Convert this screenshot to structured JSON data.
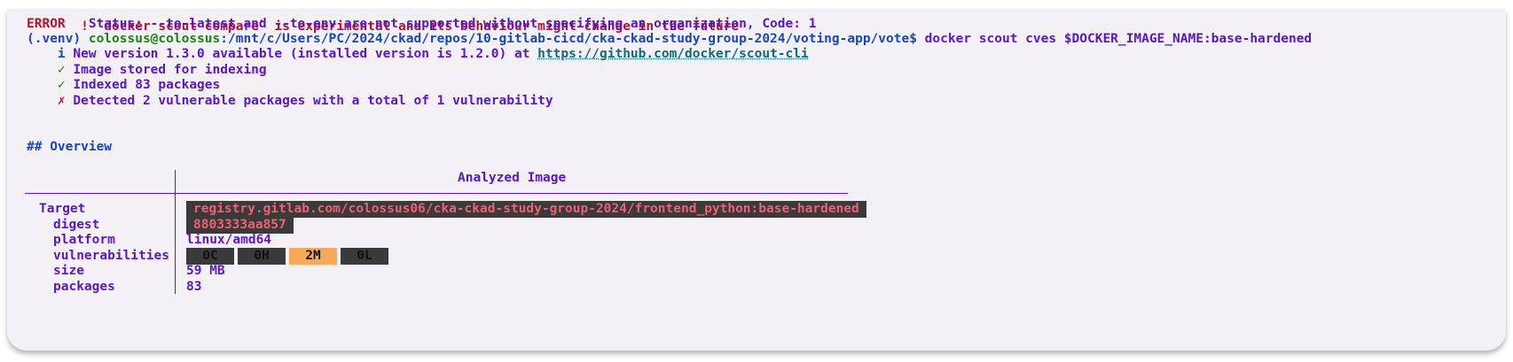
{
  "terminal": {
    "warning_line": "   ! `docker scout compare` is experimental and its behaviour might change in the future",
    "error_label": "ERROR",
    "error_text": "   Status: --to-latest and --to-env are not supported without specifying an organization, Code: 1",
    "prompt_venv": "(.venv) ",
    "prompt_user": "colossus@colossus",
    "prompt_path": ":/mnt/c/Users/PC/2024/ckad/repos/10-gitlab-cicd/cka-ckad-study-group-2024/voting-app/vote$",
    "command": " docker scout cves $DOCKER_IMAGE_NAME:base-hardened",
    "info_icon": "    i",
    "info_text": " New version 1.3.0 available (installed version is 1.2.0) at ",
    "info_link": "https://github.com/docker/scout-cli",
    "check_icon": "    ✓",
    "stored_text": " Image stored for indexing",
    "indexed_text": " Indexed 83 packages",
    "cross_icon": "    ✗",
    "detected_text": " Detected 2 vulnerable packages with a total of 1 vulnerability",
    "overview_heading": "## Overview"
  },
  "overview": {
    "column_header": "Analyzed Image",
    "labels": {
      "target": "Target",
      "digest": "digest",
      "platform": "platform",
      "vulnerabilities": "vulnerabilities",
      "size": "size",
      "packages": "packages"
    },
    "values": {
      "target": "registry.gitlab.com/colossus06/cka-ckad-study-group-2024/frontend_python:base-hardened",
      "digest": "8803333aa857",
      "platform": "linux/amd64",
      "size": "59 MB",
      "packages": "83"
    },
    "vulns": {
      "critical": "0C",
      "high": "0H",
      "medium": "2M",
      "low": "0L"
    },
    "badge_colors": {
      "neutral_bg": "#3a3a3a",
      "medium_bg": "#f7a95a"
    }
  }
}
